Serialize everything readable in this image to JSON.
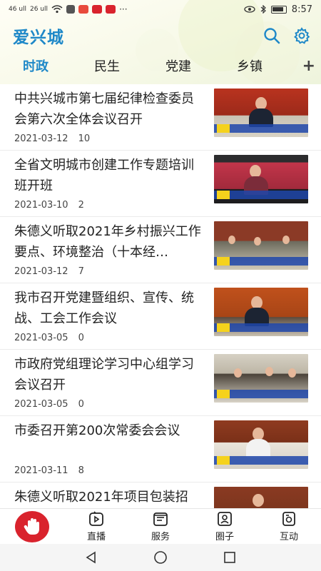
{
  "status_bar": {
    "signal_1": "46 ull",
    "signal_2": "26 ull",
    "time": "8:57",
    "colors": {
      "app1": "#e84a3c",
      "app2": "#d9232d",
      "app3": "#d9232d"
    }
  },
  "header": {
    "app_title": "爱兴城",
    "search_icon": "search-icon",
    "settings_icon": "gear-icon"
  },
  "tabs": [
    {
      "label": "时政",
      "active": true
    },
    {
      "label": "民生",
      "active": false
    },
    {
      "label": "党建",
      "active": false
    },
    {
      "label": "乡镇",
      "active": false
    }
  ],
  "tab_more": "+",
  "news": [
    {
      "title": "中共兴城市第七届纪律检查委员会第六次全体会议召开",
      "date": "2021-03-12",
      "count": "10"
    },
    {
      "title": "全省文明城市创建工作专题培训班开班",
      "date": "2021-03-10",
      "count": "2"
    },
    {
      "title": "朱德义听取2021年乡村振兴工作要点、环境整治（十本经…",
      "date": "2021-03-12",
      "count": "7"
    },
    {
      "title": "我市召开党建暨组织、宣传、统战、工会工作会议",
      "date": "2021-03-05",
      "count": "0"
    },
    {
      "title": "市政府党组理论学习中心组学习会议召开",
      "date": "2021-03-05",
      "count": "0"
    },
    {
      "title": "市委召开第200次常委会会议",
      "date": "2021-03-11",
      "count": "8"
    },
    {
      "title": "朱德义听取2021年项目包装招",
      "date": "",
      "count": ""
    }
  ],
  "bottom_nav": [
    {
      "label": "直播",
      "icon": "live-icon"
    },
    {
      "label": "服务",
      "icon": "service-icon"
    },
    {
      "label": "圈子",
      "icon": "circle-icon"
    },
    {
      "label": "互动",
      "icon": "interaction-icon"
    }
  ],
  "colors": {
    "accent": "#1e88c8",
    "home_button": "#d9232d"
  }
}
